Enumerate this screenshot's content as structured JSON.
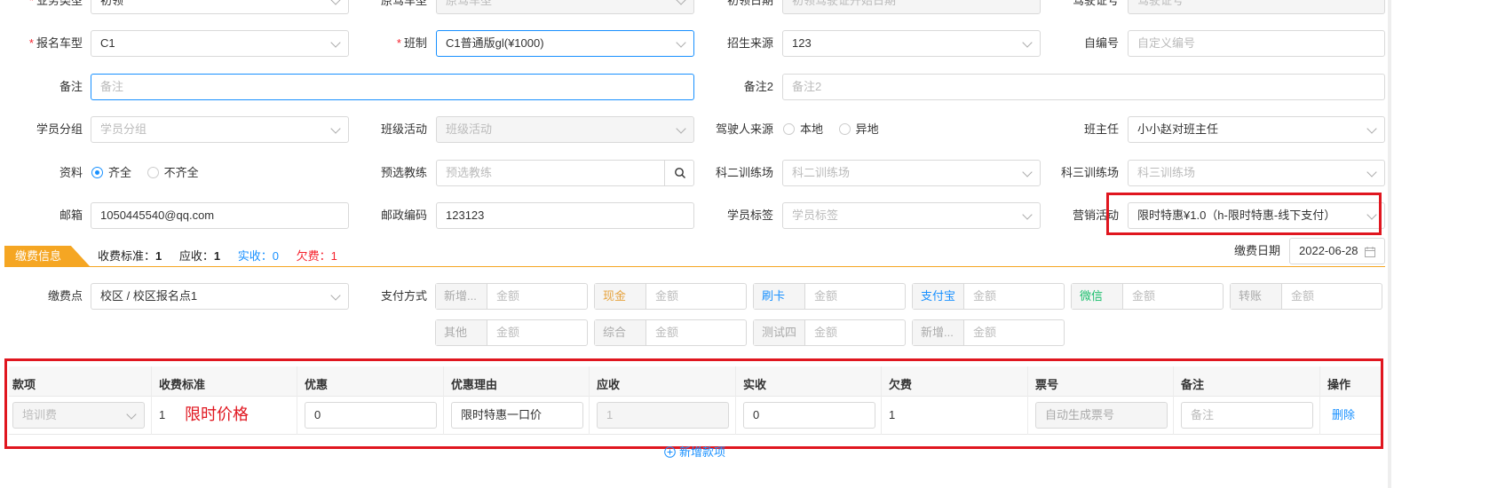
{
  "form": {
    "row0": {
      "business_type_label": "业务类型",
      "business_type_value": "初领",
      "orig_car_label": "原驾车型",
      "orig_car_placeholder": "原驾车型",
      "first_date_label": "初领日期",
      "first_date_placeholder": "初领驾驶证开始日期",
      "license_label": "驾驶证号",
      "license_placeholder": "驾驶证号"
    },
    "row1": {
      "car_type_label": "报名车型",
      "car_type_value": "C1",
      "class_label": "班制",
      "class_value": "C1普通版gl(¥1000)",
      "source_label": "招生来源",
      "source_value": "123",
      "selfno_label": "自编号",
      "selfno_placeholder": "自定义编号"
    },
    "row2": {
      "remark_label": "备注",
      "remark_placeholder": "备注",
      "remark2_label": "备注2",
      "remark2_placeholder": "备注2"
    },
    "row3": {
      "group_label": "学员分组",
      "group_placeholder": "学员分组",
      "activity_label": "班级活动",
      "activity_placeholder": "班级活动",
      "driver_source_label": "驾驶人来源",
      "driver_source_opt1": "本地",
      "driver_source_opt2": "异地",
      "head_teacher_label": "班主任",
      "head_teacher_value": "小小赵对班主任"
    },
    "row4": {
      "docs_label": "资料",
      "docs_opt1": "齐全",
      "docs_opt2": "不齐全",
      "coach_label": "预选教练",
      "coach_placeholder": "预选教练",
      "field2_label": "科二训练场",
      "field2_placeholder": "科二训练场",
      "field3_label": "科三训练场",
      "field3_placeholder": "科三训练场"
    },
    "row5": {
      "email_label": "邮箱",
      "email_value": "1050445540@qq.com",
      "postcode_label": "邮政编码",
      "postcode_value": "123123",
      "tag_label": "学员标签",
      "tag_placeholder": "学员标签",
      "promo_label": "营销活动",
      "promo_value": "限时特惠¥1.0（h-限时特惠-线下支付）"
    }
  },
  "payment": {
    "tab_label": "缴费信息",
    "standard_label": "收费标准：",
    "standard_value": "1",
    "receivable_label": "应收：",
    "receivable_value": "1",
    "received_label": "实收：",
    "received_value": "0",
    "owed_label": "欠费：",
    "owed_value": "1",
    "date_label": "缴费日期",
    "date_value": "2022-06-28",
    "point_label": "缴费点",
    "point_value": "校区 / 校区报名点1",
    "method_label": "支付方式",
    "amount_placeholder": "金额",
    "methods": [
      {
        "name": "新增...",
        "color": "#aaaaaa"
      },
      {
        "name": "现金",
        "color": "#e6a23c"
      },
      {
        "name": "刷卡",
        "color": "#1890ff"
      },
      {
        "name": "支付宝",
        "color": "#1890ff"
      },
      {
        "name": "微信",
        "color": "#19be6b"
      },
      {
        "name": "转账",
        "color": "#aaaaaa"
      },
      {
        "name": "其他",
        "color": "#aaaaaa"
      },
      {
        "name": "综合",
        "color": "#aaaaaa"
      },
      {
        "name": "测试四",
        "color": "#aaaaaa"
      },
      {
        "name": "新增...",
        "color": "#aaaaaa"
      }
    ]
  },
  "table": {
    "headers": [
      "款项",
      "收费标准",
      "优惠",
      "优惠理由",
      "应收",
      "实收",
      "欠费",
      "票号",
      "备注",
      "操作"
    ],
    "row": {
      "item_placeholder": "培训费",
      "standard": "1",
      "annotation": "限时价格",
      "discount": "0",
      "reason": "限时特惠一口价",
      "receivable": "1",
      "received": "0",
      "owed": "1",
      "ticket_placeholder": "自动生成票号",
      "remark_placeholder": "备注",
      "delete_label": "删除"
    },
    "add_label": "新增款项"
  },
  "colors": {
    "accent": "#1890ff",
    "highlight": "#e0161f",
    "tab_orange": "#f5a623"
  }
}
